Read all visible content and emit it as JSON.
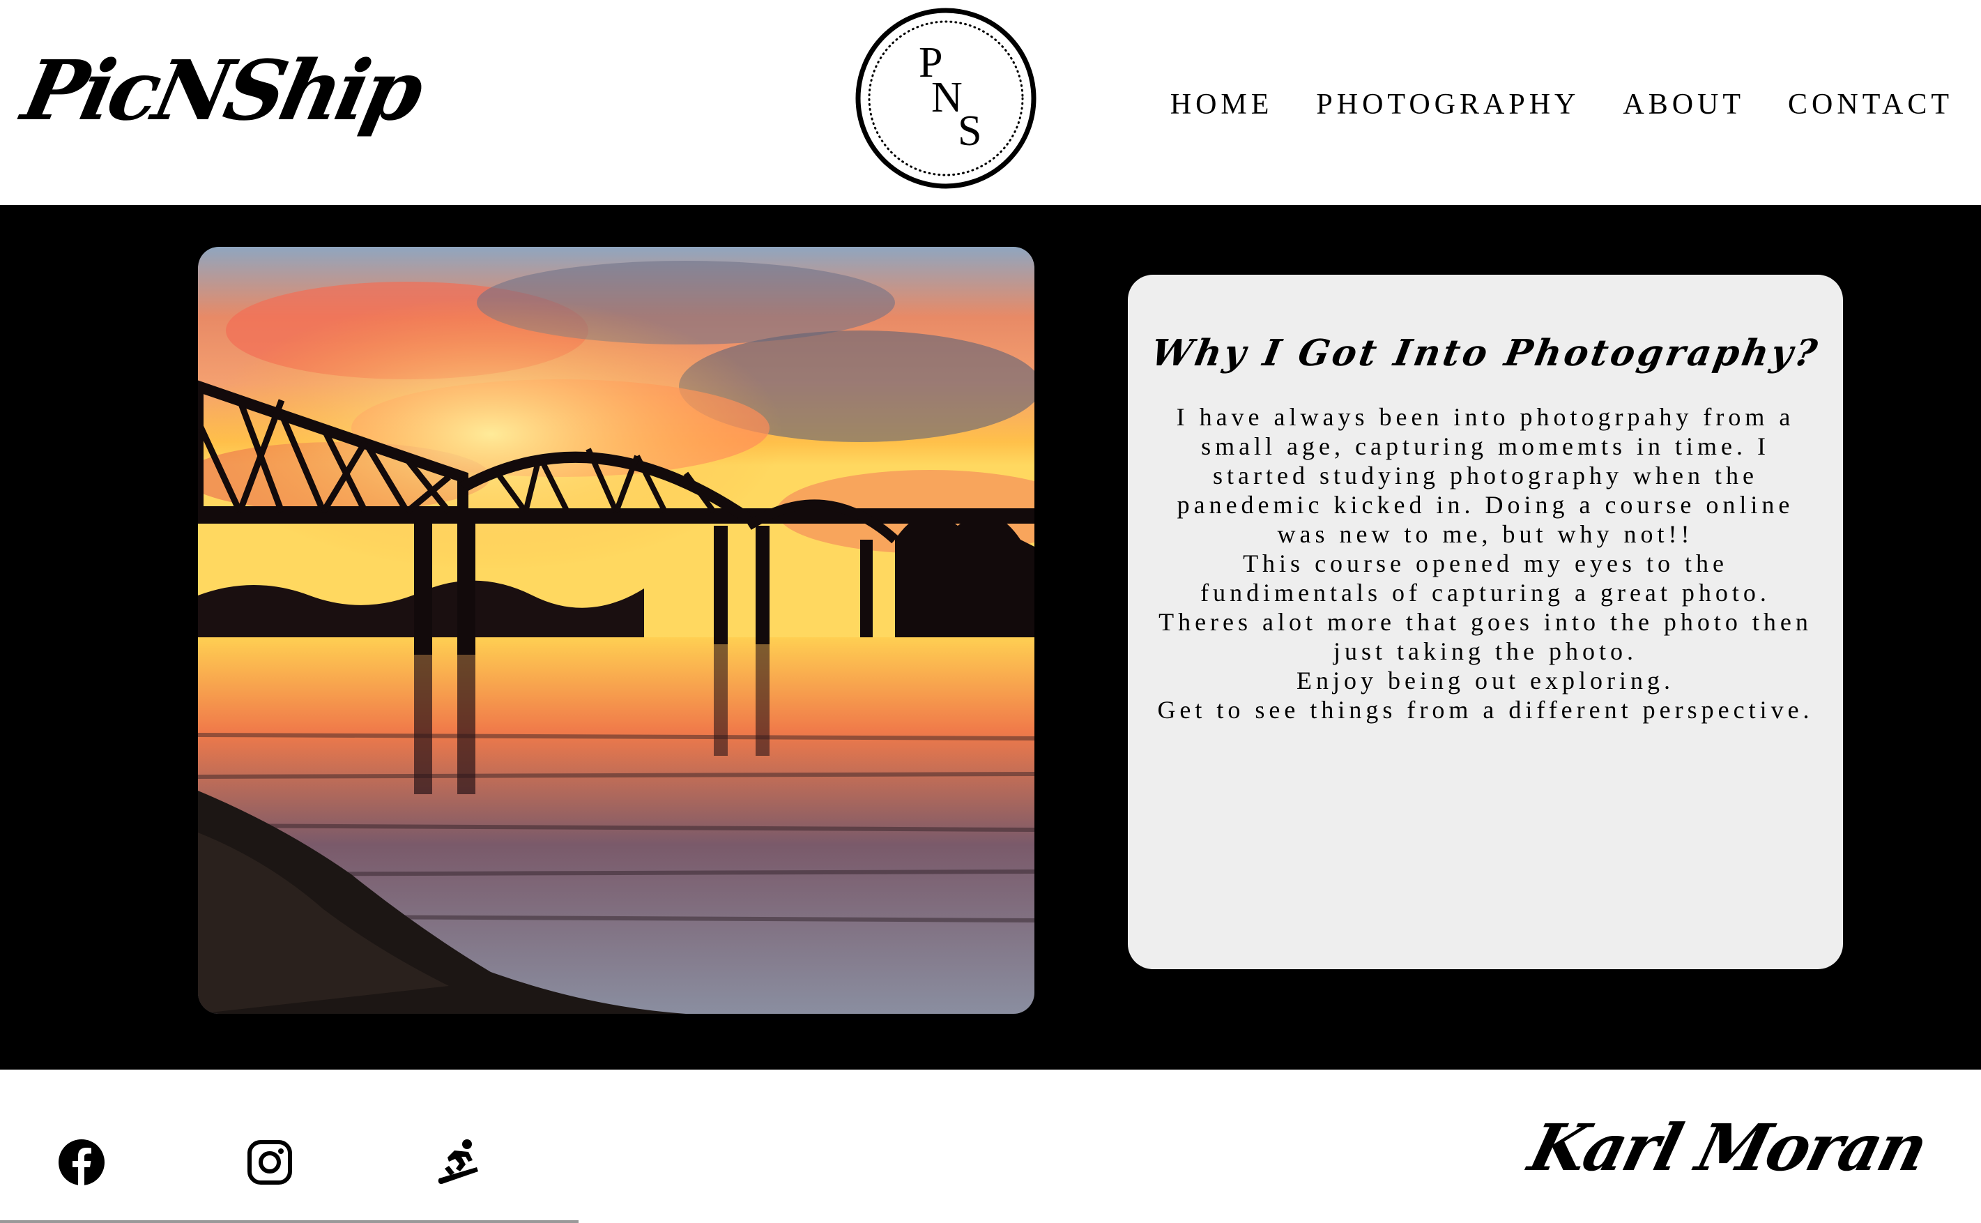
{
  "header": {
    "brand": "PicNShip",
    "emblem": {
      "letters": [
        "P",
        "N",
        "S"
      ]
    },
    "nav": [
      {
        "label": "HOME"
      },
      {
        "label": "PHOTOGRAPHY"
      },
      {
        "label": "ABOUT"
      },
      {
        "label": "CONTACT"
      }
    ]
  },
  "hero": {
    "photo_subject": "sunset-bridge-over-river",
    "card": {
      "title": "Why I Got Into Photography?",
      "paragraphs": [
        "I have always been into photogrpahy from a small age, capturing momemts in time. I started studying photography when the panedemic kicked in. Doing a course online was new to me, but why not!!",
        "This course opened my eyes to the fundimentals of capturing a great photo. Theres alot more that goes into the photo then just taking the photo.",
        "Enjoy being out exploring.",
        "Get to see things from a different perspective."
      ]
    }
  },
  "footer": {
    "social": [
      {
        "icon": "facebook-icon"
      },
      {
        "icon": "instagram-icon"
      },
      {
        "icon": "snowboarder-icon"
      }
    ],
    "signature": "Karl Moran"
  },
  "colors": {
    "hero_background": "#000000",
    "card_background": "#eeeeee",
    "text": "#000000"
  }
}
